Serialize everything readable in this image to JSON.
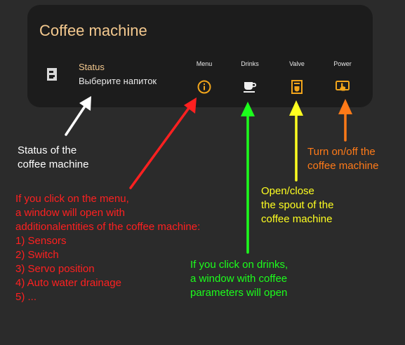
{
  "card": {
    "title": "Coffee machine",
    "status_label": "Status",
    "status_value": "Выберите напиток"
  },
  "controls": [
    {
      "label": "Menu",
      "icon": "info-icon"
    },
    {
      "label": "Drinks",
      "icon": "coffee-cup-icon"
    },
    {
      "label": "Valve",
      "icon": "coffee-maker-icon"
    },
    {
      "label": "Power",
      "icon": "power-touch-icon"
    }
  ],
  "colors": {
    "card_title": "#f4c98f",
    "icon_accent": "#f2a51b",
    "annotation_status": "#ffffff",
    "annotation_menu": "#ff2020",
    "annotation_drinks": "#1cff1c",
    "annotation_valve": "#ffff20",
    "annotation_power": "#ff7a18"
  },
  "annotations": {
    "status": [
      "Status of the",
      "coffee machine"
    ],
    "menu": [
      "If you click on the menu,",
      "a window will open with",
      "additionalentities of the coffee machine:",
      "1) Sensors",
      "2) Switch",
      "3) Servo position",
      "4) Auto water drainage",
      "5) ..."
    ],
    "drinks": [
      "If you click on drinks,",
      "a window with coffee",
      "parameters will open"
    ],
    "valve": [
      "Open/close",
      "the spout of the",
      "coffee machine"
    ],
    "power": [
      "Turn on/off the",
      "coffee machine"
    ]
  }
}
